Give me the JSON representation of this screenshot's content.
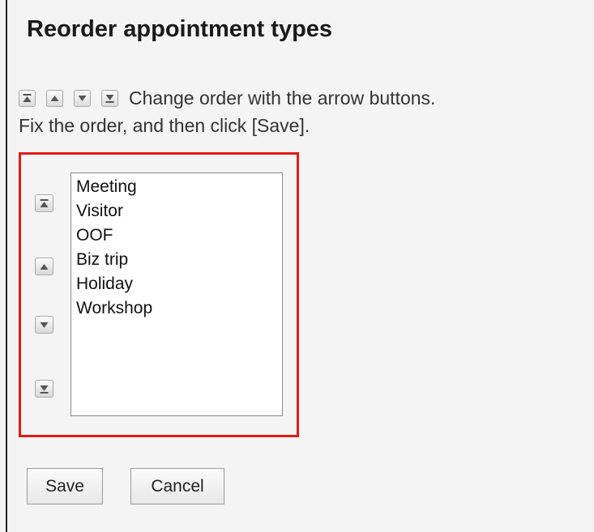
{
  "title": "Reorder appointment types",
  "instructions": {
    "line1": "Change order with the arrow buttons.",
    "line2": "Fix the order, and then click [Save]."
  },
  "order_controls": [
    {
      "name": "move-to-top",
      "icon": "move-top-icon"
    },
    {
      "name": "move-up",
      "icon": "move-up-icon"
    },
    {
      "name": "move-down",
      "icon": "move-down-icon"
    },
    {
      "name": "move-to-bottom",
      "icon": "move-bottom-icon"
    }
  ],
  "appointment_types": [
    "Meeting",
    "Visitor",
    "OOF",
    "Biz trip",
    "Holiday",
    "Workshop"
  ],
  "buttons": {
    "save": "Save",
    "cancel": "Cancel"
  },
  "colors": {
    "highlight": "#e21b1b",
    "background": "#f4f4f4"
  }
}
